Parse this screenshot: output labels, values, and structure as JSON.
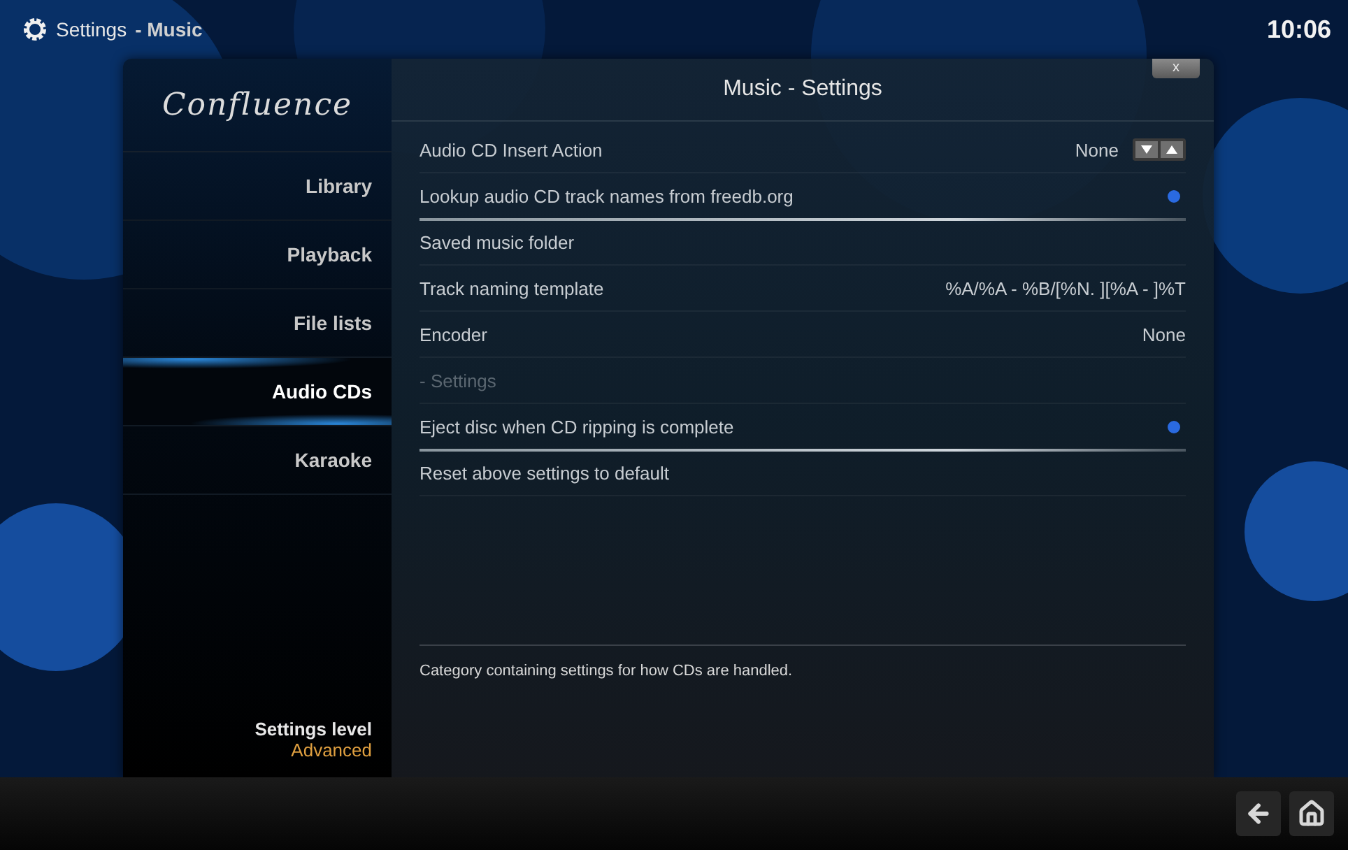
{
  "header": {
    "title": "Settings",
    "section": "- Music",
    "clock": "10:06"
  },
  "sidebar": {
    "logo": "Confluence",
    "items": [
      {
        "label": "Library",
        "selected": false
      },
      {
        "label": "Playback",
        "selected": false
      },
      {
        "label": "File lists",
        "selected": false
      },
      {
        "label": "Audio CDs",
        "selected": true
      },
      {
        "label": "Karaoke",
        "selected": false
      }
    ],
    "level_label": "Settings level",
    "level_value": "Advanced"
  },
  "dialog": {
    "title": "Music - Settings",
    "close": "x",
    "rows": [
      {
        "kind": "spinner",
        "label": "Audio CD Insert Action",
        "value": "None",
        "disabled": false
      },
      {
        "kind": "toggle",
        "label": "Lookup audio CD track names from freedb.org",
        "on": true,
        "disabled": false
      },
      {
        "kind": "separator"
      },
      {
        "kind": "text",
        "label": "Saved music folder",
        "disabled": false
      },
      {
        "kind": "text",
        "label": "Track naming template",
        "value": "%A/%A - %B/[%N. ][%A - ]%T",
        "disabled": false
      },
      {
        "kind": "text",
        "label": "Encoder",
        "value": "None",
        "disabled": false
      },
      {
        "kind": "text",
        "label": "- Settings",
        "disabled": true
      },
      {
        "kind": "toggle",
        "label": "Eject disc when CD ripping is complete",
        "on": true,
        "disabled": false
      },
      {
        "kind": "separator"
      },
      {
        "kind": "text",
        "label": "Reset above settings to default",
        "disabled": false
      }
    ],
    "description": "Category containing settings for how CDs are handled."
  }
}
